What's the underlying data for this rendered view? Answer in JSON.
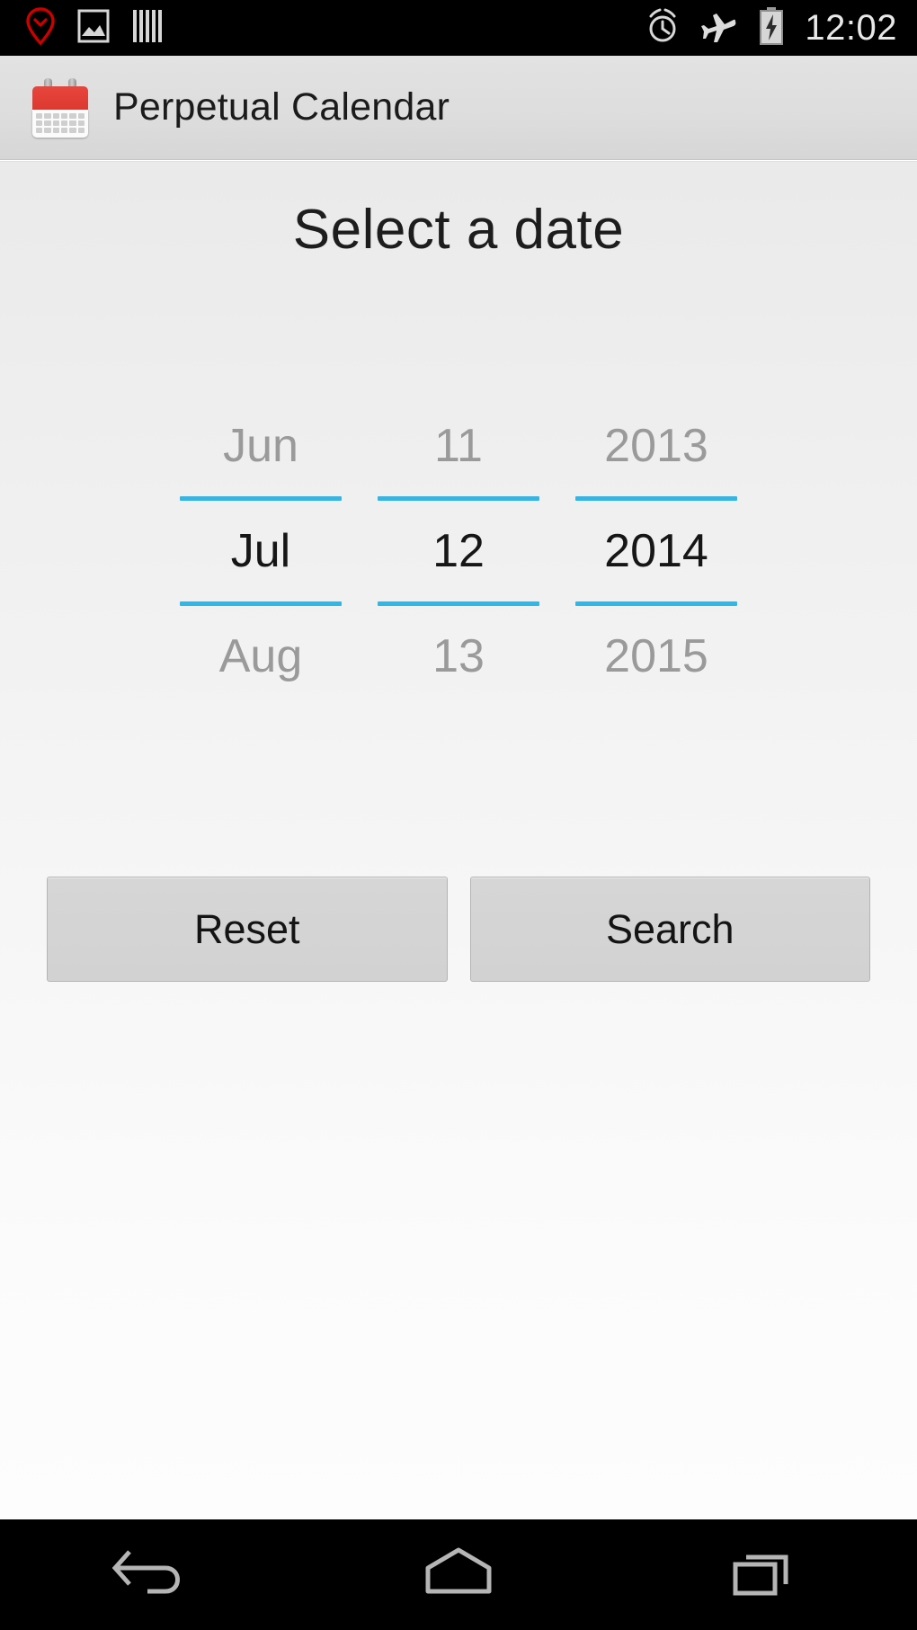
{
  "statusbar": {
    "time": "12:02",
    "left_icons": [
      {
        "name": "location-pin-check-icon",
        "label": "location"
      },
      {
        "name": "photo-icon",
        "label": "gallery"
      },
      {
        "name": "barcode-icon",
        "label": "barcode"
      }
    ],
    "right_icons": [
      {
        "name": "alarm-clock-icon",
        "label": "alarm"
      },
      {
        "name": "airplane-mode-icon",
        "label": "airplane mode"
      },
      {
        "name": "battery-charging-icon",
        "label": "battery charging"
      }
    ]
  },
  "actionbar": {
    "app_title": "Perpetual Calendar",
    "app_icon": "calendar-icon"
  },
  "main": {
    "page_title": "Select a date",
    "picker": {
      "columns": [
        {
          "key": "month",
          "previous": "Jun",
          "selected": "Jul",
          "next": "Aug"
        },
        {
          "key": "day",
          "previous": "11",
          "selected": "12",
          "next": "13"
        },
        {
          "key": "year",
          "previous": "2013",
          "selected": "2014",
          "next": "2015"
        }
      ],
      "accent_color": "#33b5e5"
    },
    "buttons": {
      "reset_label": "Reset",
      "search_label": "Search"
    }
  },
  "navbar": {
    "items": [
      {
        "name": "back-button",
        "label": "Back"
      },
      {
        "name": "home-button",
        "label": "Home"
      },
      {
        "name": "recents-button",
        "label": "Recents"
      }
    ]
  }
}
